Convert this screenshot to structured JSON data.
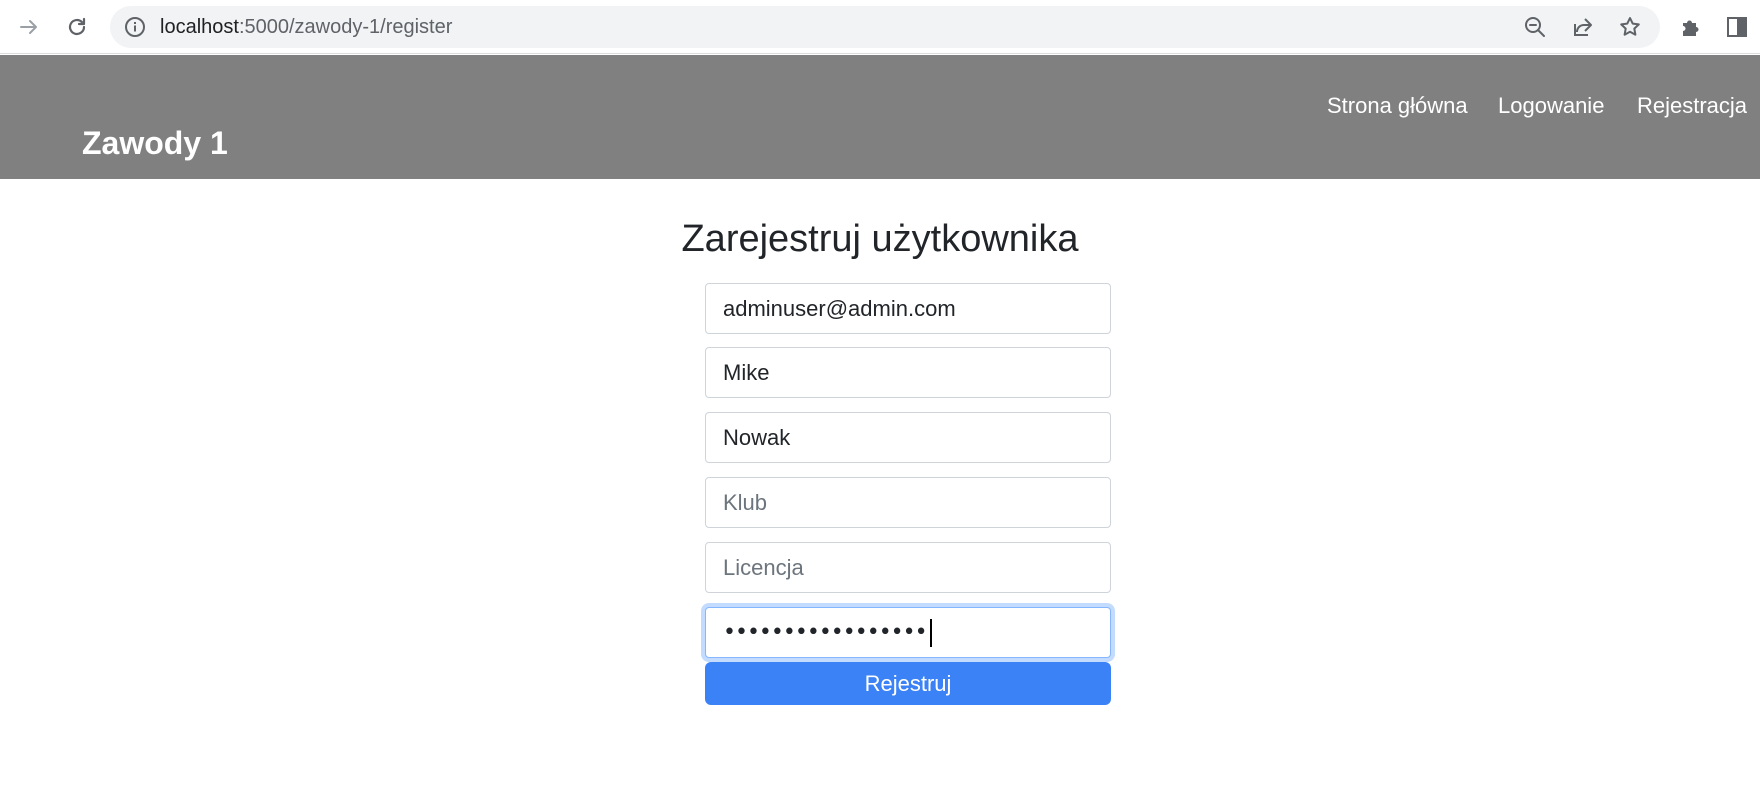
{
  "browser": {
    "url_host": "localhost",
    "url_path": ":5000/zawody-1/register"
  },
  "navbar": {
    "brand": "Zawody 1",
    "links": [
      "Strona główna",
      "Logowanie",
      "Rejestracja"
    ]
  },
  "form": {
    "title": "Zarejestruj użytkownika",
    "email": {
      "value": "adminuser@admin.com"
    },
    "first_name": {
      "value": "Mike"
    },
    "last_name": {
      "value": "Nowak"
    },
    "club": {
      "value": "",
      "placeholder": "Klub"
    },
    "license": {
      "value": "",
      "placeholder": "Licencja"
    },
    "password_masked": "•••••••••••••••••",
    "submit_label": "Rejestruj"
  }
}
